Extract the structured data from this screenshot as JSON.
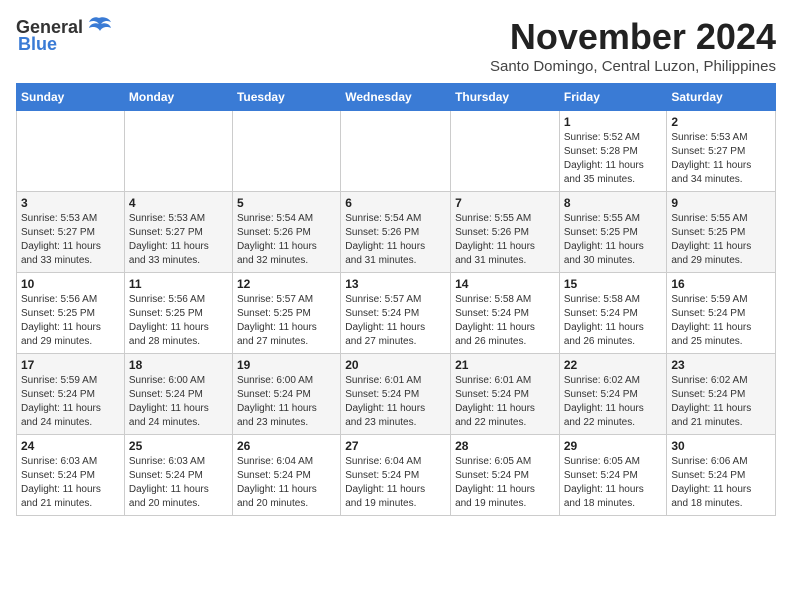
{
  "logo": {
    "general": "General",
    "blue": "Blue"
  },
  "title": {
    "month": "November 2024",
    "location": "Santo Domingo, Central Luzon, Philippines"
  },
  "headers": [
    "Sunday",
    "Monday",
    "Tuesday",
    "Wednesday",
    "Thursday",
    "Friday",
    "Saturday"
  ],
  "weeks": [
    [
      {
        "day": "",
        "info": ""
      },
      {
        "day": "",
        "info": ""
      },
      {
        "day": "",
        "info": ""
      },
      {
        "day": "",
        "info": ""
      },
      {
        "day": "",
        "info": ""
      },
      {
        "day": "1",
        "info": "Sunrise: 5:52 AM\nSunset: 5:28 PM\nDaylight: 11 hours\nand 35 minutes."
      },
      {
        "day": "2",
        "info": "Sunrise: 5:53 AM\nSunset: 5:27 PM\nDaylight: 11 hours\nand 34 minutes."
      }
    ],
    [
      {
        "day": "3",
        "info": "Sunrise: 5:53 AM\nSunset: 5:27 PM\nDaylight: 11 hours\nand 33 minutes."
      },
      {
        "day": "4",
        "info": "Sunrise: 5:53 AM\nSunset: 5:27 PM\nDaylight: 11 hours\nand 33 minutes."
      },
      {
        "day": "5",
        "info": "Sunrise: 5:54 AM\nSunset: 5:26 PM\nDaylight: 11 hours\nand 32 minutes."
      },
      {
        "day": "6",
        "info": "Sunrise: 5:54 AM\nSunset: 5:26 PM\nDaylight: 11 hours\nand 31 minutes."
      },
      {
        "day": "7",
        "info": "Sunrise: 5:55 AM\nSunset: 5:26 PM\nDaylight: 11 hours\nand 31 minutes."
      },
      {
        "day": "8",
        "info": "Sunrise: 5:55 AM\nSunset: 5:25 PM\nDaylight: 11 hours\nand 30 minutes."
      },
      {
        "day": "9",
        "info": "Sunrise: 5:55 AM\nSunset: 5:25 PM\nDaylight: 11 hours\nand 29 minutes."
      }
    ],
    [
      {
        "day": "10",
        "info": "Sunrise: 5:56 AM\nSunset: 5:25 PM\nDaylight: 11 hours\nand 29 minutes."
      },
      {
        "day": "11",
        "info": "Sunrise: 5:56 AM\nSunset: 5:25 PM\nDaylight: 11 hours\nand 28 minutes."
      },
      {
        "day": "12",
        "info": "Sunrise: 5:57 AM\nSunset: 5:25 PM\nDaylight: 11 hours\nand 27 minutes."
      },
      {
        "day": "13",
        "info": "Sunrise: 5:57 AM\nSunset: 5:24 PM\nDaylight: 11 hours\nand 27 minutes."
      },
      {
        "day": "14",
        "info": "Sunrise: 5:58 AM\nSunset: 5:24 PM\nDaylight: 11 hours\nand 26 minutes."
      },
      {
        "day": "15",
        "info": "Sunrise: 5:58 AM\nSunset: 5:24 PM\nDaylight: 11 hours\nand 26 minutes."
      },
      {
        "day": "16",
        "info": "Sunrise: 5:59 AM\nSunset: 5:24 PM\nDaylight: 11 hours\nand 25 minutes."
      }
    ],
    [
      {
        "day": "17",
        "info": "Sunrise: 5:59 AM\nSunset: 5:24 PM\nDaylight: 11 hours\nand 24 minutes."
      },
      {
        "day": "18",
        "info": "Sunrise: 6:00 AM\nSunset: 5:24 PM\nDaylight: 11 hours\nand 24 minutes."
      },
      {
        "day": "19",
        "info": "Sunrise: 6:00 AM\nSunset: 5:24 PM\nDaylight: 11 hours\nand 23 minutes."
      },
      {
        "day": "20",
        "info": "Sunrise: 6:01 AM\nSunset: 5:24 PM\nDaylight: 11 hours\nand 23 minutes."
      },
      {
        "day": "21",
        "info": "Sunrise: 6:01 AM\nSunset: 5:24 PM\nDaylight: 11 hours\nand 22 minutes."
      },
      {
        "day": "22",
        "info": "Sunrise: 6:02 AM\nSunset: 5:24 PM\nDaylight: 11 hours\nand 22 minutes."
      },
      {
        "day": "23",
        "info": "Sunrise: 6:02 AM\nSunset: 5:24 PM\nDaylight: 11 hours\nand 21 minutes."
      }
    ],
    [
      {
        "day": "24",
        "info": "Sunrise: 6:03 AM\nSunset: 5:24 PM\nDaylight: 11 hours\nand 21 minutes."
      },
      {
        "day": "25",
        "info": "Sunrise: 6:03 AM\nSunset: 5:24 PM\nDaylight: 11 hours\nand 20 minutes."
      },
      {
        "day": "26",
        "info": "Sunrise: 6:04 AM\nSunset: 5:24 PM\nDaylight: 11 hours\nand 20 minutes."
      },
      {
        "day": "27",
        "info": "Sunrise: 6:04 AM\nSunset: 5:24 PM\nDaylight: 11 hours\nand 19 minutes."
      },
      {
        "day": "28",
        "info": "Sunrise: 6:05 AM\nSunset: 5:24 PM\nDaylight: 11 hours\nand 19 minutes."
      },
      {
        "day": "29",
        "info": "Sunrise: 6:05 AM\nSunset: 5:24 PM\nDaylight: 11 hours\nand 18 minutes."
      },
      {
        "day": "30",
        "info": "Sunrise: 6:06 AM\nSunset: 5:24 PM\nDaylight: 11 hours\nand 18 minutes."
      }
    ]
  ]
}
